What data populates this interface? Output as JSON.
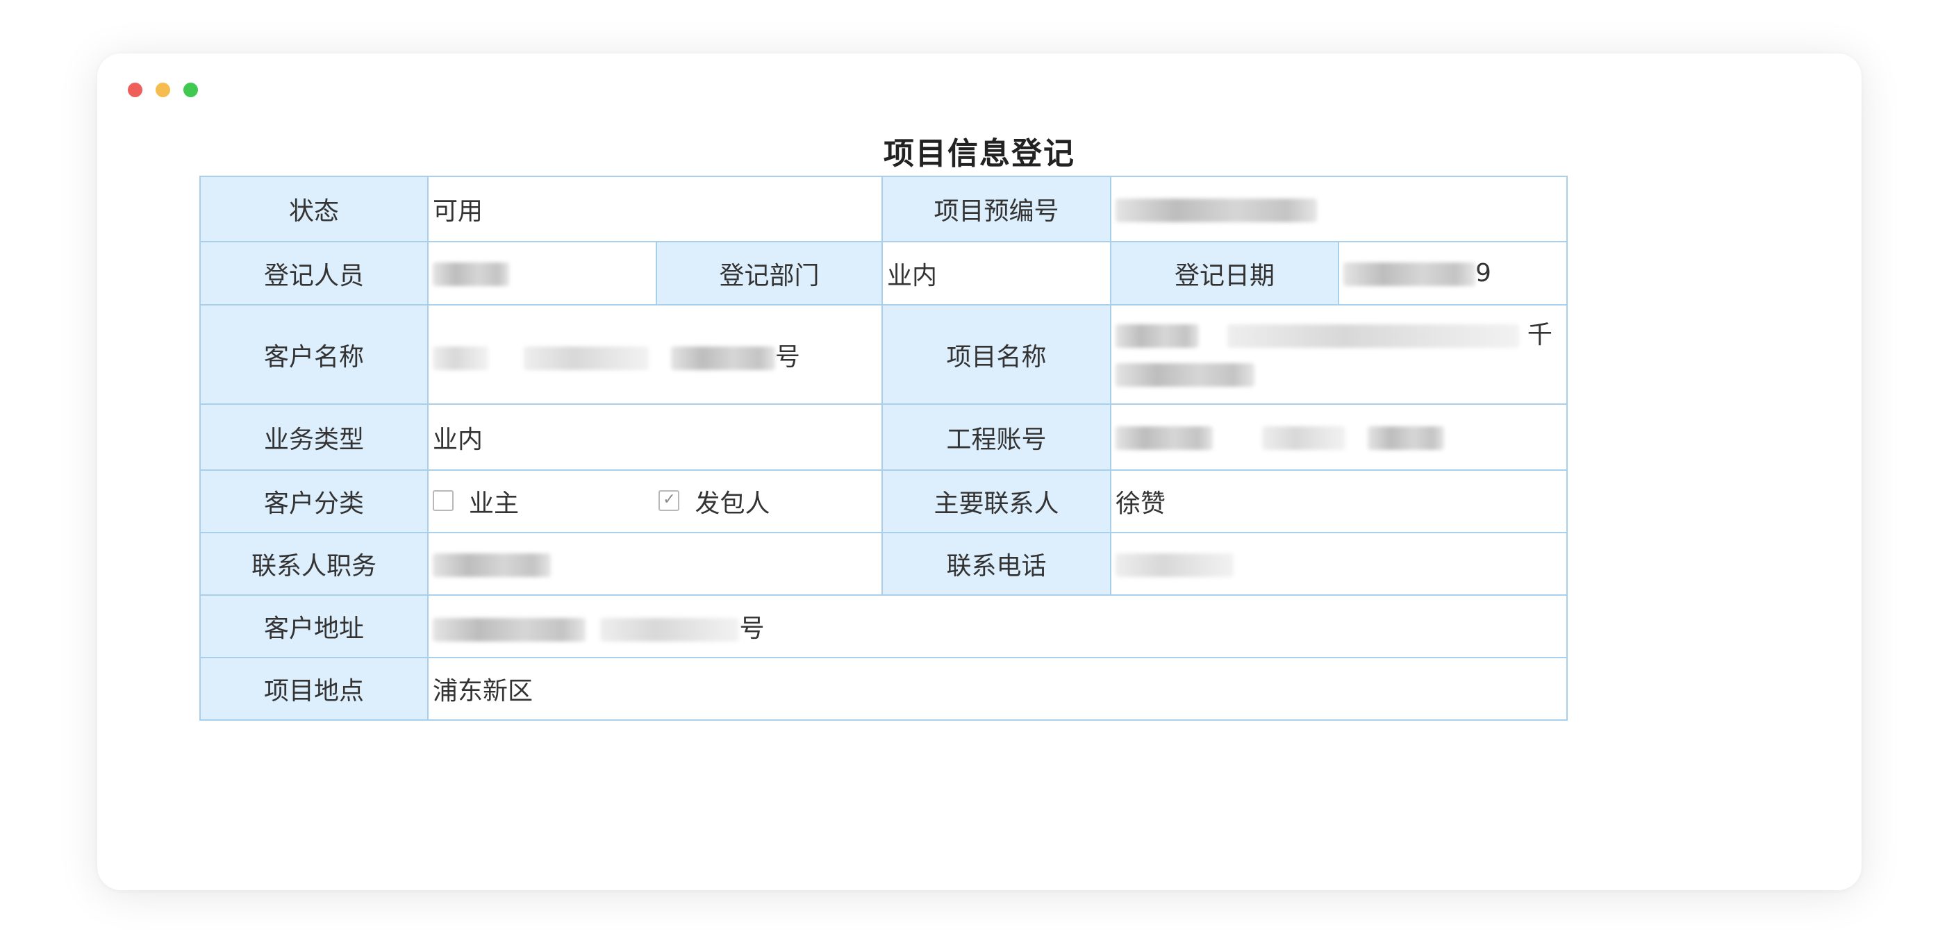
{
  "window": {
    "controls": {
      "close_color": "#ee5f5b",
      "minimize_color": "#f5bd4f",
      "maximize_color": "#3fc950"
    }
  },
  "page": {
    "title": "项目信息登记"
  },
  "form": {
    "status_label": "状态",
    "status_value": "可用",
    "pre_number_label": "项目预编号",
    "pre_number_value": "",
    "registrar_label": "登记人员",
    "registrar_value": "",
    "department_label": "登记部门",
    "department_value": "业内",
    "date_label": "登记日期",
    "date_value_tail": "9",
    "client_name_label": "客户名称",
    "client_name_tail": "号",
    "project_name_label": "项目名称",
    "project_name_tail": "千",
    "business_type_label": "业务类型",
    "business_type_value": "业内",
    "account_label": "工程账号",
    "account_value": "",
    "client_category_label": "客户分类",
    "client_category_options": [
      {
        "label": "业主",
        "checked": false
      },
      {
        "label": "发包人",
        "checked": true
      }
    ],
    "main_contact_label": "主要联系人",
    "main_contact_value": "徐赞",
    "contact_position_label": "联系人职务",
    "contact_position_value": "",
    "phone_label": "联系电话",
    "phone_value": "",
    "client_address_label": "客户地址",
    "client_address_tail": "号",
    "project_location_label": "项目地点",
    "project_location_value": "浦东新区"
  },
  "icons": {
    "checkbox_checked": "check-icon"
  }
}
